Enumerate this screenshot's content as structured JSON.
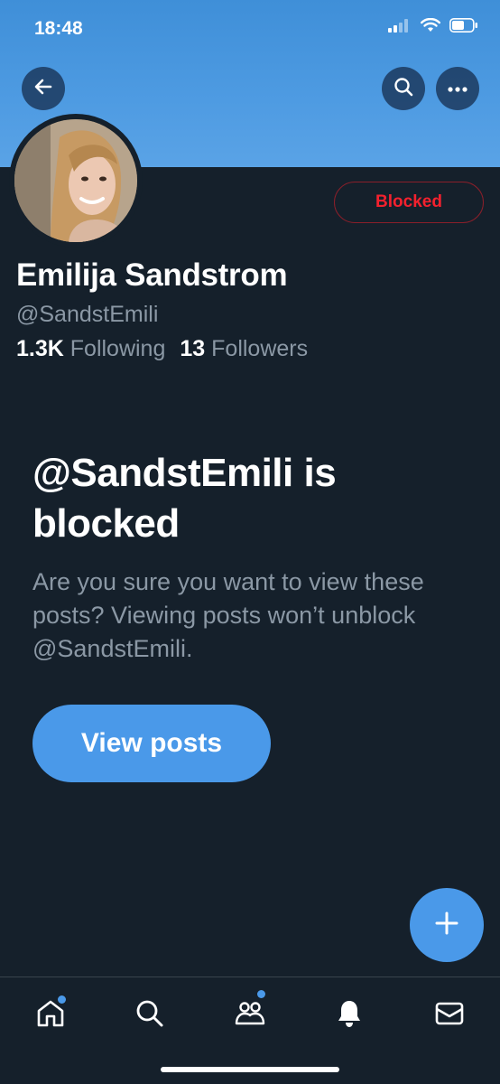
{
  "status_bar": {
    "time": "18:48",
    "icons": [
      "signal-icon",
      "wifi-icon",
      "battery-icon"
    ]
  },
  "header": {
    "back_icon": "arrow-left-icon",
    "search_icon": "search-icon",
    "more_icon": "more-icon"
  },
  "profile": {
    "display_name": "Emilija Sandstrom",
    "handle": "@SandstEmili",
    "following_count": "1.3K",
    "following_label": "Following",
    "followers_count": "13",
    "followers_label": "Followers",
    "blocked_label": "Blocked"
  },
  "blocked_notice": {
    "title": "@SandstEmili is blocked",
    "description": "Are you sure you want to view these posts? Viewing posts won’t unblock @SandstEmili.",
    "button_label": "View posts"
  },
  "fab": {
    "icon": "plus-icon"
  },
  "tab_bar": {
    "items": [
      {
        "icon": "home-icon",
        "has_dot": true
      },
      {
        "icon": "search-icon",
        "has_dot": false
      },
      {
        "icon": "communities-icon",
        "has_dot": true
      },
      {
        "icon": "bell-icon",
        "has_dot": false
      },
      {
        "icon": "mail-icon",
        "has_dot": false
      }
    ]
  },
  "colors": {
    "background": "#15202b",
    "accent": "#4a99e9",
    "blocked_red": "#f4212e",
    "muted_text": "#8b98a5",
    "banner": "#4e9be2"
  }
}
